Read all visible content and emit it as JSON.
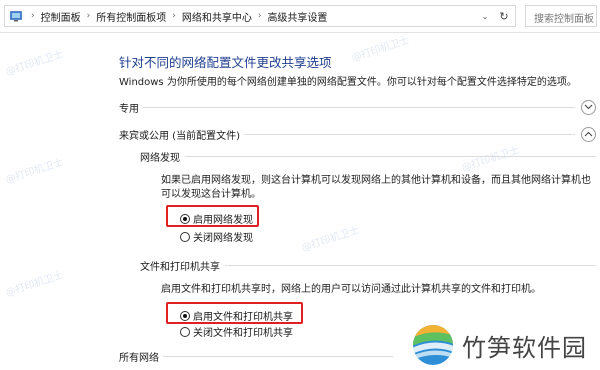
{
  "address_bar": {
    "breadcrumbs": [
      "控制面板",
      "所有控制面板项",
      "网络和共享中心",
      "高级共享设置"
    ],
    "search_placeholder": "搜索控制面板"
  },
  "main": {
    "title": "针对不同的网络配置文件更改共享选项",
    "description": "Windows 为你所使用的每个网络创建单独的网络配置文件。你可以针对每个配置文件选择特定的选项。",
    "sections": {
      "private": {
        "label": "专用",
        "state": "collapsed"
      },
      "guest_public": {
        "label": "来宾或公用 (当前配置文件)",
        "state": "expanded",
        "network_discovery": {
          "label": "网络发现",
          "text_line1": "如果已启用网络发现，则这台计算机可以发现网络上的其他计算机和设备，而且其他网络计算机也",
          "text_line2": "可以发现这台计算机。",
          "options": [
            {
              "label": "启用网络发现",
              "selected": true
            },
            {
              "label": "关闭网络发现",
              "selected": false
            }
          ]
        },
        "file_printer_sharing": {
          "label": "文件和打印机共享",
          "text": "启用文件和打印机共享时，网络上的用户可以访问通过此计算机共享的文件和打印机。",
          "options": [
            {
              "label": "启用文件和打印机共享",
              "selected": true
            },
            {
              "label": "关闭文件和打印机共享",
              "selected": false
            }
          ]
        }
      },
      "all_networks": {
        "label": "所有网络"
      }
    }
  },
  "watermark": {
    "text": "@打印机卫士"
  },
  "logo": {
    "text": "竹笋软件园",
    "colors": [
      "#2e8fd6",
      "#5cc15e",
      "#f2b233"
    ]
  },
  "colors": {
    "title": "#1f3f8f",
    "highlight": "#e02020"
  }
}
